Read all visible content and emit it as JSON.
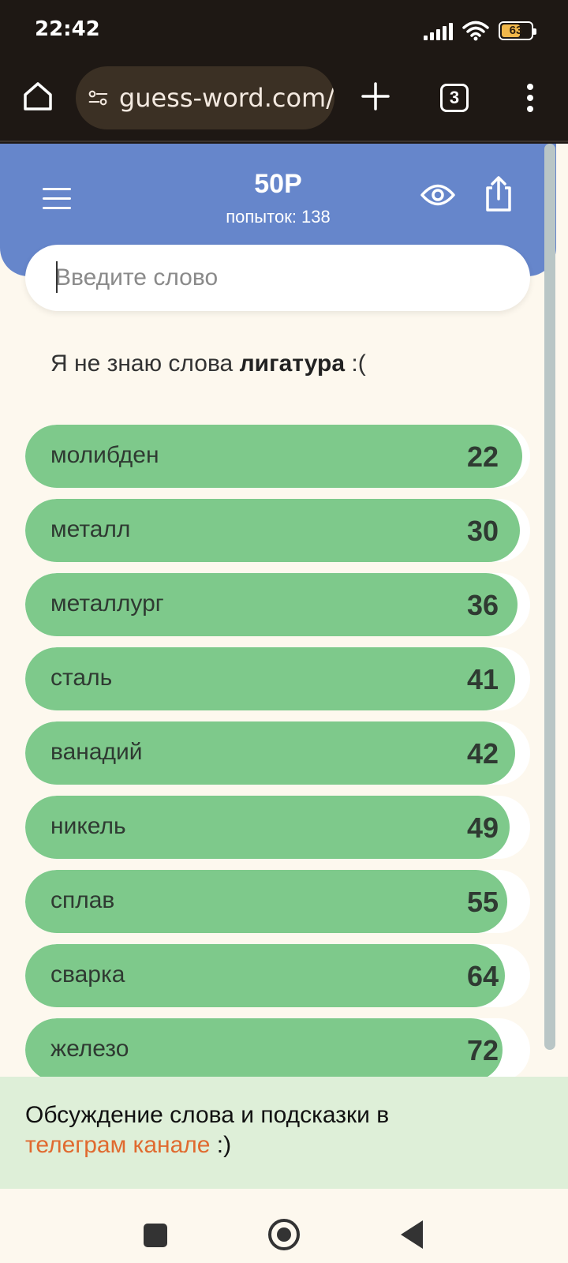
{
  "status_bar": {
    "time": "22:42",
    "battery": "63",
    "battery_level": 0.63
  },
  "browser": {
    "url": "guess-word.com/",
    "tab_count": "3"
  },
  "header": {
    "title": "50P",
    "attempts": "попыток: 138"
  },
  "search": {
    "placeholder": "Введите слово",
    "value": ""
  },
  "message": {
    "prefix": "Я не знаю слова",
    "word": "лигатура",
    "suffix": ":("
  },
  "words": [
    {
      "word": "молибден",
      "score": "22",
      "closeness": 0.985
    },
    {
      "word": "металл",
      "score": "30",
      "closeness": 0.98
    },
    {
      "word": "металлург",
      "score": "36",
      "closeness": 0.975
    },
    {
      "word": "сталь",
      "score": "41",
      "closeness": 0.97
    },
    {
      "word": "ванадий",
      "score": "42",
      "closeness": 0.97
    },
    {
      "word": "никель",
      "score": "49",
      "closeness": 0.96
    },
    {
      "word": "сплав",
      "score": "55",
      "closeness": 0.955
    },
    {
      "word": "сварка",
      "score": "64",
      "closeness": 0.95
    },
    {
      "word": "железо",
      "score": "72",
      "closeness": 0.945
    }
  ],
  "footer": {
    "text": "Обсуждение слова и подсказки в",
    "link": "телеграм канале",
    "suffix": " :)"
  },
  "colors": {
    "header": "#6686cb",
    "word_bar": "#7ec98b",
    "link": "#e06a2f",
    "footer_bg": "#deefd8"
  }
}
